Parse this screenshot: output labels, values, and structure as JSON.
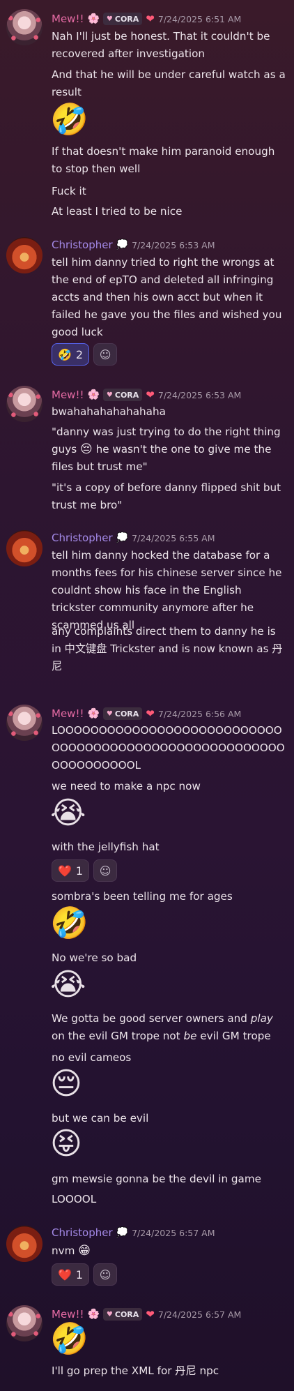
{
  "users": {
    "mew": {
      "name": "Mew!!",
      "role_emoji": "🌸",
      "tag": "CORA",
      "tag_heart": "♥",
      "heart": "❤"
    },
    "chris": {
      "name": "Christopher",
      "role_emoji": "💭"
    }
  },
  "messages": [
    {
      "time": "7/24/2025 6:51 AM",
      "lines": [
        "Nah I'll just be honest. That it couldn't be recovered after investigation",
        "And that he will be under careful watch as a result",
        "🤣",
        "If that doesn't make him paranoid enough to stop then well",
        "Fuck it",
        "At least I tried to be nice"
      ]
    },
    {
      "time": "7/24/2025 6:53 AM",
      "lines": [
        "tell him danny tried to right the wrongs at the end of epTO and deleted all infringing accts and then his own acct but when it failed he gave you the files and wished you good luck"
      ],
      "reaction": {
        "emoji": "🤣",
        "count": "2"
      }
    },
    {
      "time": "7/24/2025 6:53 AM",
      "lines": [
        "bwahahahahahahaha",
        "\"danny was just trying to do the right thing guys",
        "he wasn't the one to give me the files but trust me\"",
        "\"it's a copy of before danny flipped shit but trust me bro\""
      ],
      "inline_emoji": "😔"
    },
    {
      "time": "7/24/2025 6:55 AM",
      "lines": [
        "tell him danny hocked the database for a months fees for his chinese server since he couldnt show his face in the English trickster community anymore after he scammed us all",
        "any complaints direct them to danny he is in 中文键盘 Trickster and is now known as 丹尼"
      ]
    },
    {
      "time": "7/24/2025 6:56 AM",
      "lines": [
        "LOOOOOOOOOOOOOOOOOOOOOOOOOOOOOOOOOOOOOOOOOOOOOOOOOOOOOOOOOOOOOOOOOL",
        "we need to make a npc now",
        "😭",
        "with the jellyfish hat",
        "sombra's been telling me for ages",
        "🤣",
        "No we're so bad",
        "😭",
        "We gotta be good server owners and ",
        "play",
        " on the evil GM trope not ",
        "be",
        " evil GM trope",
        "no evil cameos",
        "😔",
        "but we can be evil",
        "😝",
        "gm mewsie gonna be the devil in game",
        "LOOOOL"
      ],
      "reaction": {
        "emoji": "❤️",
        "count": "1"
      }
    },
    {
      "time": "7/24/2025 6:57 AM",
      "lines": [
        "nvm"
      ],
      "inline_emoji": "😁",
      "reaction": {
        "emoji": "❤️",
        "count": "1"
      }
    },
    {
      "time": "7/24/2025 6:57 AM",
      "lines": [
        "🤣",
        "I'll go prep the XML for 丹尼 npc"
      ]
    }
  ],
  "add_reaction_icon": "☺"
}
